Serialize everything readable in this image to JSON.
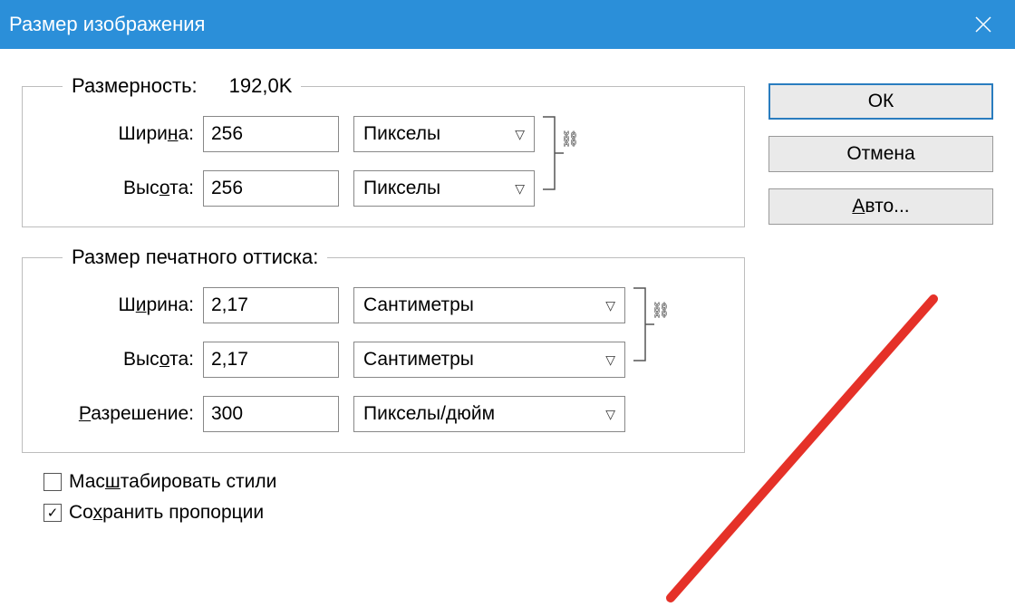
{
  "titlebar": {
    "title": "Размер изображения"
  },
  "buttons": {
    "ok": "ОК",
    "cancel": "Отмена",
    "auto": "Авто..."
  },
  "dimensions": {
    "legend_label": "Размерность:",
    "legend_value": "192,0K",
    "width_label": "Ширина:",
    "width_value": "256",
    "width_unit": "Пикселы",
    "height_label": "Высота:",
    "height_value": "256",
    "height_unit": "Пикселы"
  },
  "print": {
    "legend_label": "Размер печатного оттиска:",
    "width_label": "Ширина:",
    "width_value": "2,17",
    "width_unit": "Сантиметры",
    "height_label": "Высота:",
    "height_value": "2,17",
    "height_unit": "Сантиметры",
    "resolution_label": "Разрешение:",
    "resolution_value": "300",
    "resolution_unit": "Пикселы/дюйм"
  },
  "checks": {
    "scale_styles_label": "Масштабировать стили",
    "constrain_label": "Сохранить пропорции"
  }
}
